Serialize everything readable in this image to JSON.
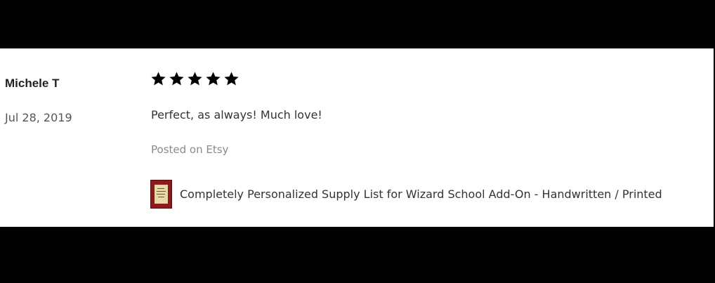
{
  "review": {
    "reviewer_name": "Michele T",
    "date": "Jul 28, 2019",
    "rating": 5,
    "max_rating": 5,
    "text": "Perfect, as always! Much love!",
    "source": "Posted on Etsy",
    "product": {
      "thumbnail_icon": "product-thumbnail",
      "title": "Completely Personalized Supply List for Wizard School Add-On - Handwritten / Printed"
    }
  },
  "colors": {
    "background_letterbox": "#000000",
    "card_background": "#ffffff",
    "star_fill": "#000000",
    "muted_text": "#8a8a8a"
  }
}
